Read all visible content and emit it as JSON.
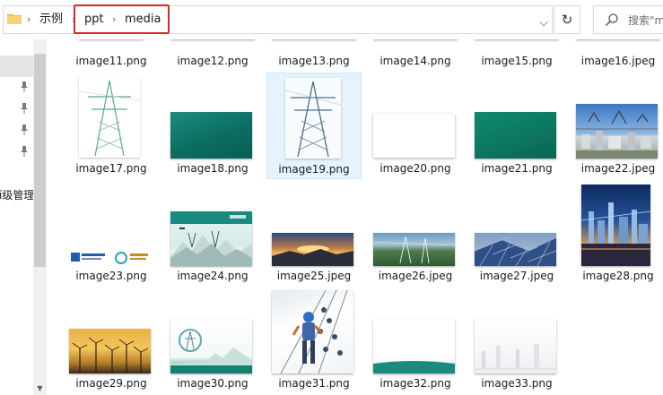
{
  "address_bar": {
    "breadcrumbs": [
      "示例",
      "ppt",
      "media"
    ]
  },
  "search": {
    "placeholder": "搜索\"m"
  },
  "nav_pane": {
    "partial_label": "ī级管理"
  },
  "files": [
    {
      "name": "image11.png"
    },
    {
      "name": "image12.png"
    },
    {
      "name": "image13.png"
    },
    {
      "name": "image14.png"
    },
    {
      "name": "image15.png"
    },
    {
      "name": "image16.jpeg"
    },
    {
      "name": "image17.png"
    },
    {
      "name": "image18.png"
    },
    {
      "name": "image19.png"
    },
    {
      "name": "image20.png"
    },
    {
      "name": "image21.png"
    },
    {
      "name": "image22.jpeg"
    },
    {
      "name": "image23.png"
    },
    {
      "name": "image24.png"
    },
    {
      "name": "image25.jpeg"
    },
    {
      "name": "image26.jpeg"
    },
    {
      "name": "image27.jpeg"
    },
    {
      "name": "image28.png"
    },
    {
      "name": "image29.png"
    },
    {
      "name": "image30.png"
    },
    {
      "name": "image31.png"
    },
    {
      "name": "image32.png"
    },
    {
      "name": "image33.png"
    }
  ],
  "selected_file": "image19.png",
  "colors": {
    "highlight_box": "#d9262b",
    "selection": "#e5f3ff",
    "teal": "#0d7a6c"
  }
}
